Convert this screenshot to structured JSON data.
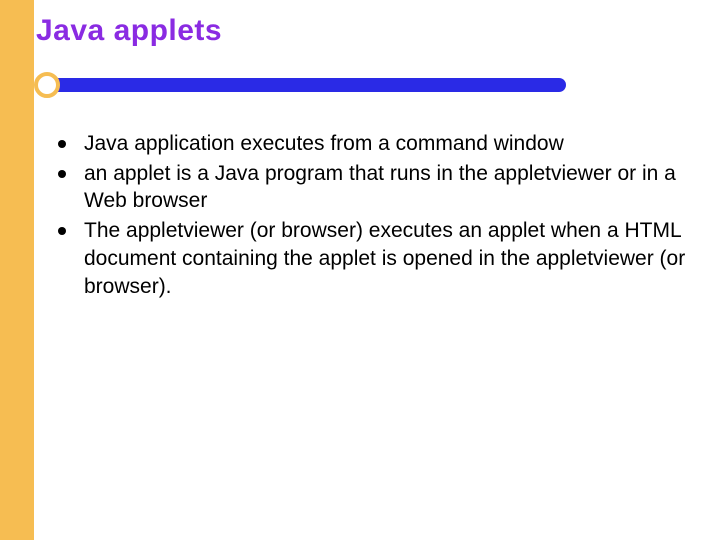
{
  "title": "Java applets",
  "bullets": [
    "Java application executes from a command window",
    "an applet is a Java program that runs in the appletviewer or in a Web browser",
    " The appletviewer (or browser) executes an applet when a HTML document containing the applet is opened in the appletviewer (or browser)."
  ]
}
